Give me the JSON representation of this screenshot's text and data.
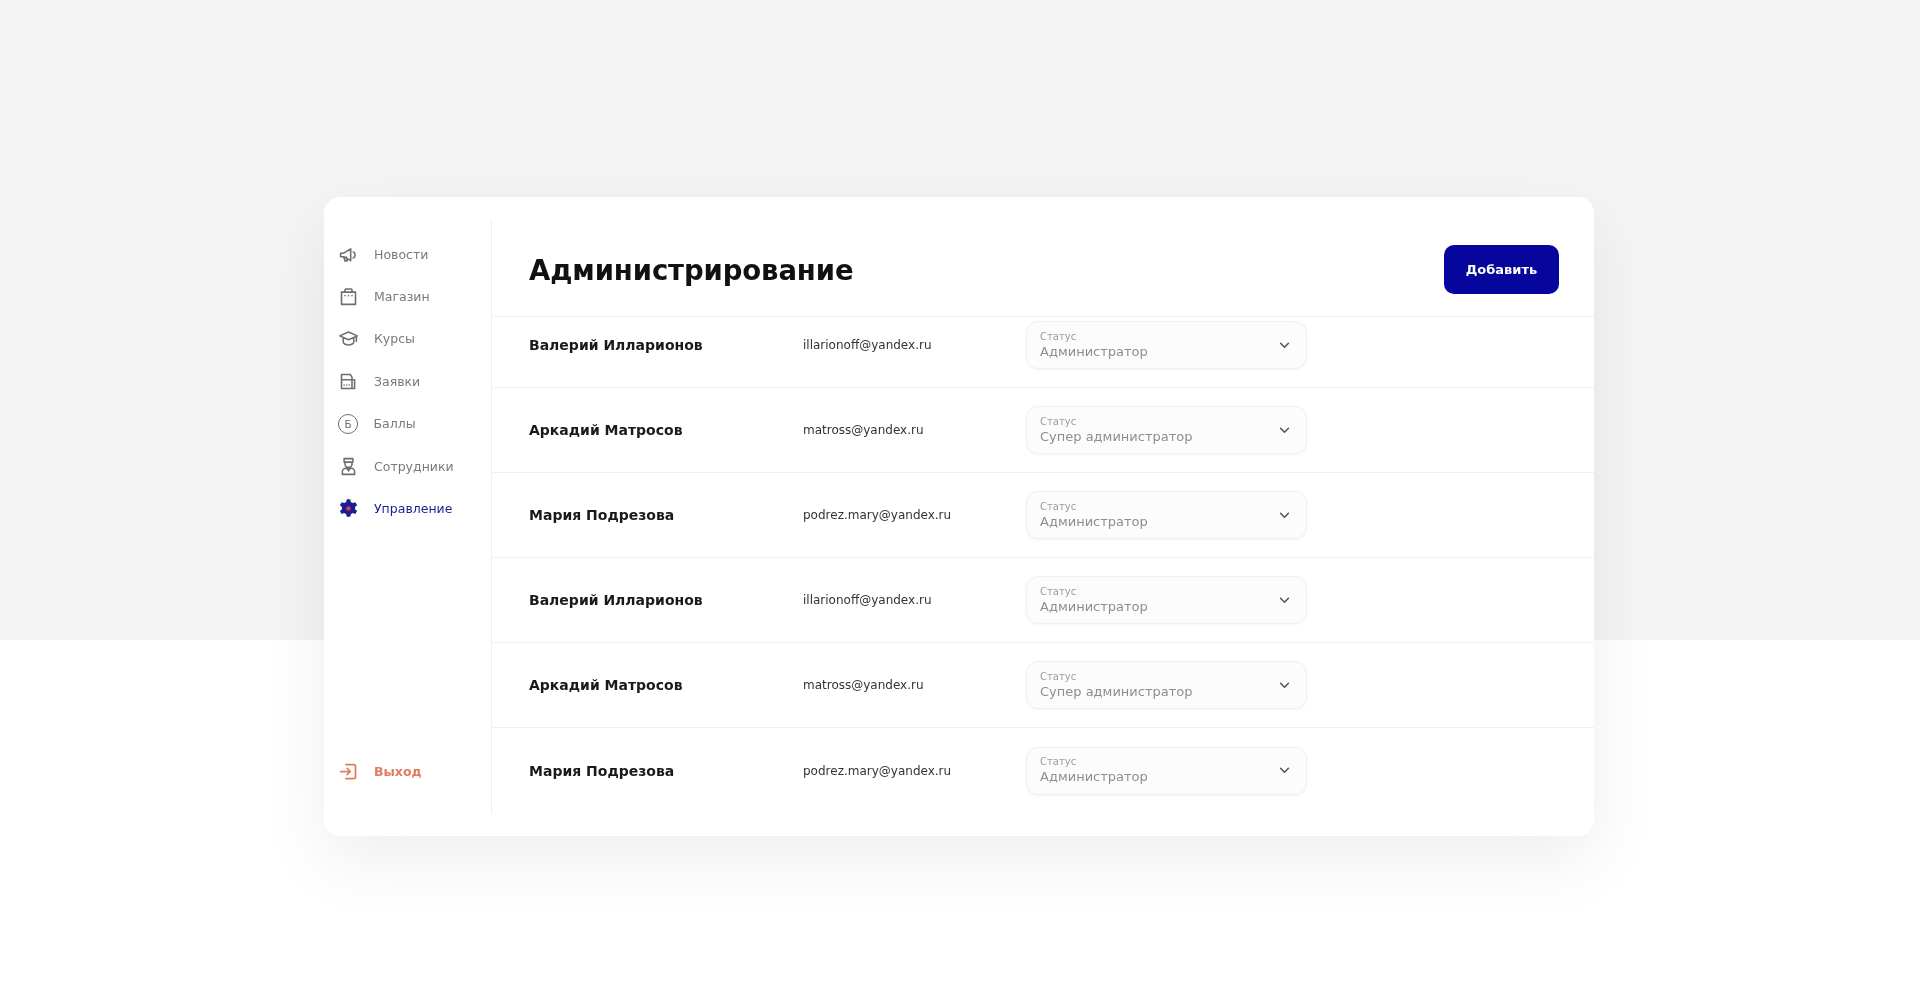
{
  "sidebar": {
    "items": [
      {
        "label": "Новости",
        "selected": false
      },
      {
        "label": "Магазин",
        "selected": false
      },
      {
        "label": "Курсы",
        "selected": false
      },
      {
        "label": "Заявки",
        "selected": false
      },
      {
        "label": "Баллы",
        "selected": false,
        "glyph": "Б"
      },
      {
        "label": "Сотрудники",
        "selected": false
      },
      {
        "label": "Управление",
        "selected": true
      }
    ],
    "logout": {
      "label": "Выход"
    }
  },
  "header": {
    "title": "Администрирование",
    "add_button": "Добавить"
  },
  "users": [
    {
      "name": "Валерий Илларионов",
      "email": "illarionoff@yandex.ru",
      "status": {
        "label": "Статус",
        "value": "Администратор"
      }
    },
    {
      "name": "Аркадий Матросов",
      "email": "matross@yandex.ru",
      "status": {
        "label": "Статус",
        "value": "Супер администратор"
      }
    },
    {
      "name": "Мария Подрезова",
      "email": "podrez.mary@yandex.ru",
      "status": {
        "label": "Статус",
        "value": "Администратор"
      }
    },
    {
      "name": "Валерий Илларионов",
      "email": "illarionoff@yandex.ru",
      "status": {
        "label": "Статус",
        "value": "Администратор"
      }
    },
    {
      "name": "Аркадий Матросов",
      "email": "matross@yandex.ru",
      "status": {
        "label": "Статус",
        "value": "Супер администратор"
      }
    },
    {
      "name": "Мария Подрезова",
      "email": "podrez.mary@yandex.ru",
      "status": {
        "label": "Статус",
        "value": "Администратор"
      }
    }
  ]
}
